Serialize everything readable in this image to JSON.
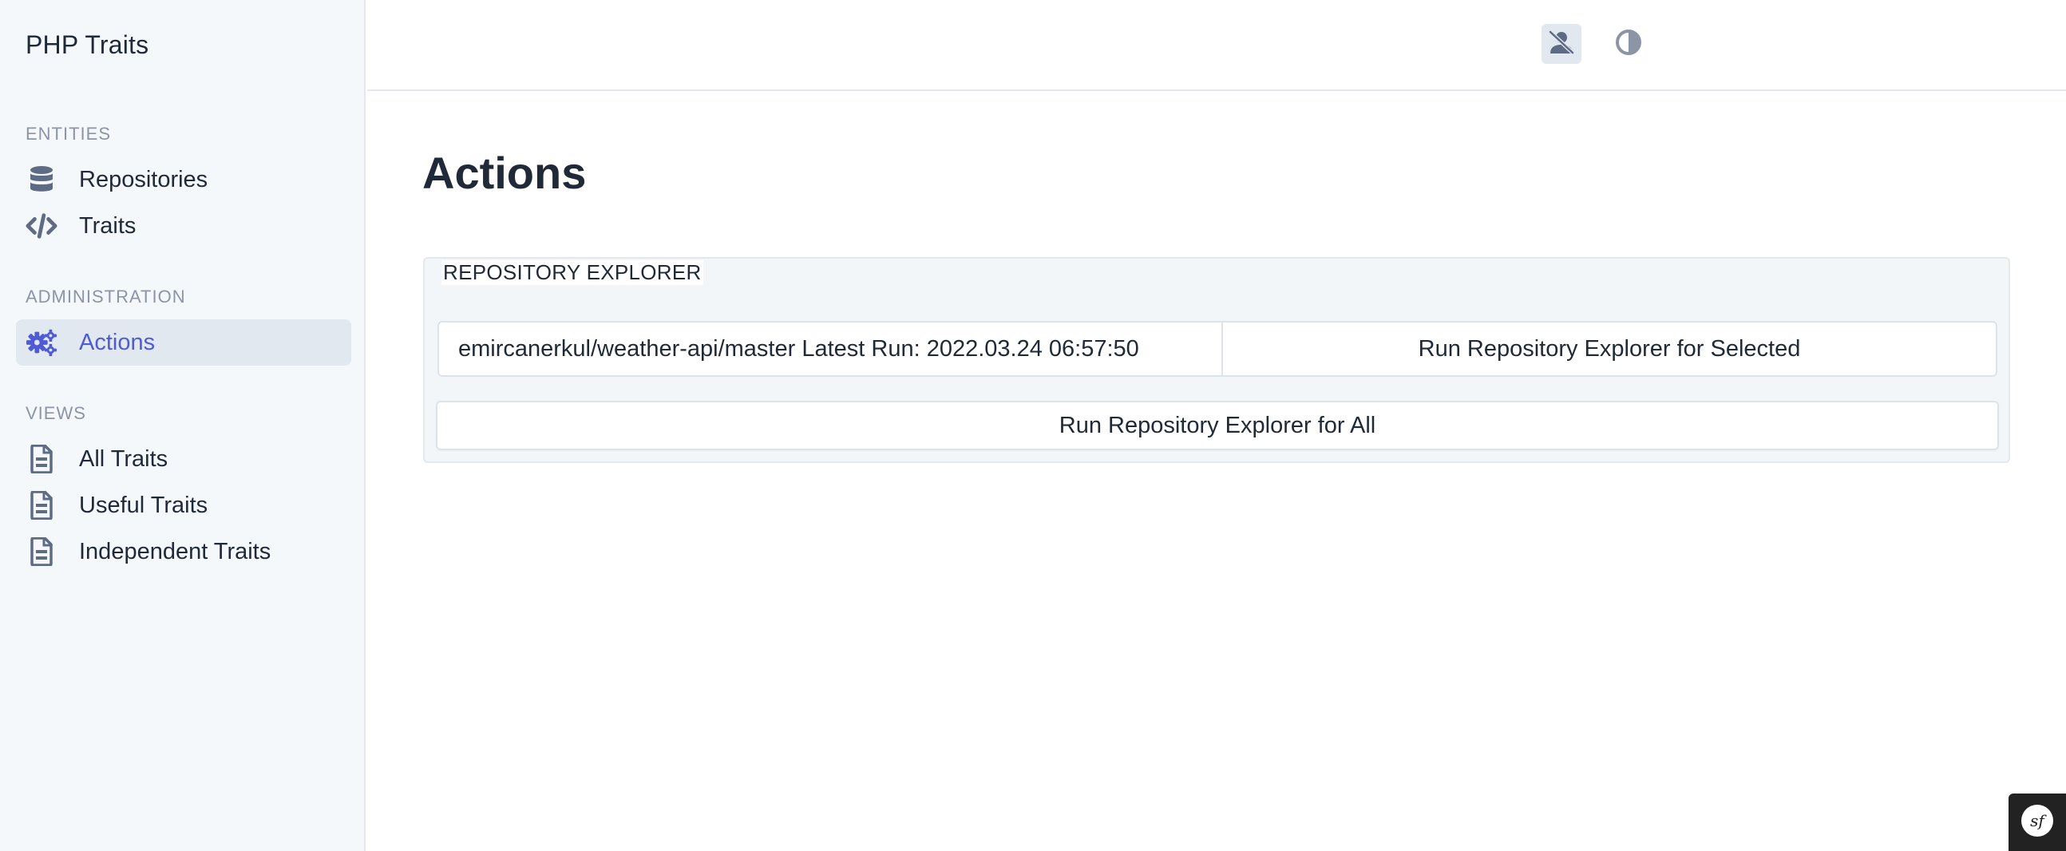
{
  "sidebar": {
    "brand": "PHP Traits",
    "sections": {
      "entities": {
        "title": "ENTITIES",
        "items": [
          {
            "label": "Repositories",
            "icon": "database-icon"
          },
          {
            "label": "Traits",
            "icon": "code-icon"
          }
        ]
      },
      "administration": {
        "title": "ADMINISTRATION",
        "items": [
          {
            "label": "Actions",
            "icon": "cogs-icon",
            "active": true
          }
        ]
      },
      "views": {
        "title": "VIEWS",
        "items": [
          {
            "label": "All Traits",
            "icon": "document-icon"
          },
          {
            "label": "Useful Traits",
            "icon": "document-icon"
          },
          {
            "label": "Independent Traits",
            "icon": "document-icon"
          }
        ]
      }
    }
  },
  "header": {
    "buttons": [
      {
        "icon": "user-slash-icon"
      },
      {
        "icon": "contrast-icon"
      }
    ]
  },
  "main": {
    "title": "Actions",
    "panel": {
      "legend": "REPOSITORY EXPLORER",
      "selected_value": "emircanerkul/weather-api/master Latest Run: 2022.03.24 06:57:50",
      "run_selected_label": "Run Repository Explorer for Selected",
      "run_all_label": "Run Repository Explorer for All"
    }
  },
  "colors": {
    "accent": "#4f5bd5",
    "sidebar_bg": "#f5f8fb",
    "icon_gray": "#5f6b84",
    "active_bg": "#e2e8f0"
  }
}
